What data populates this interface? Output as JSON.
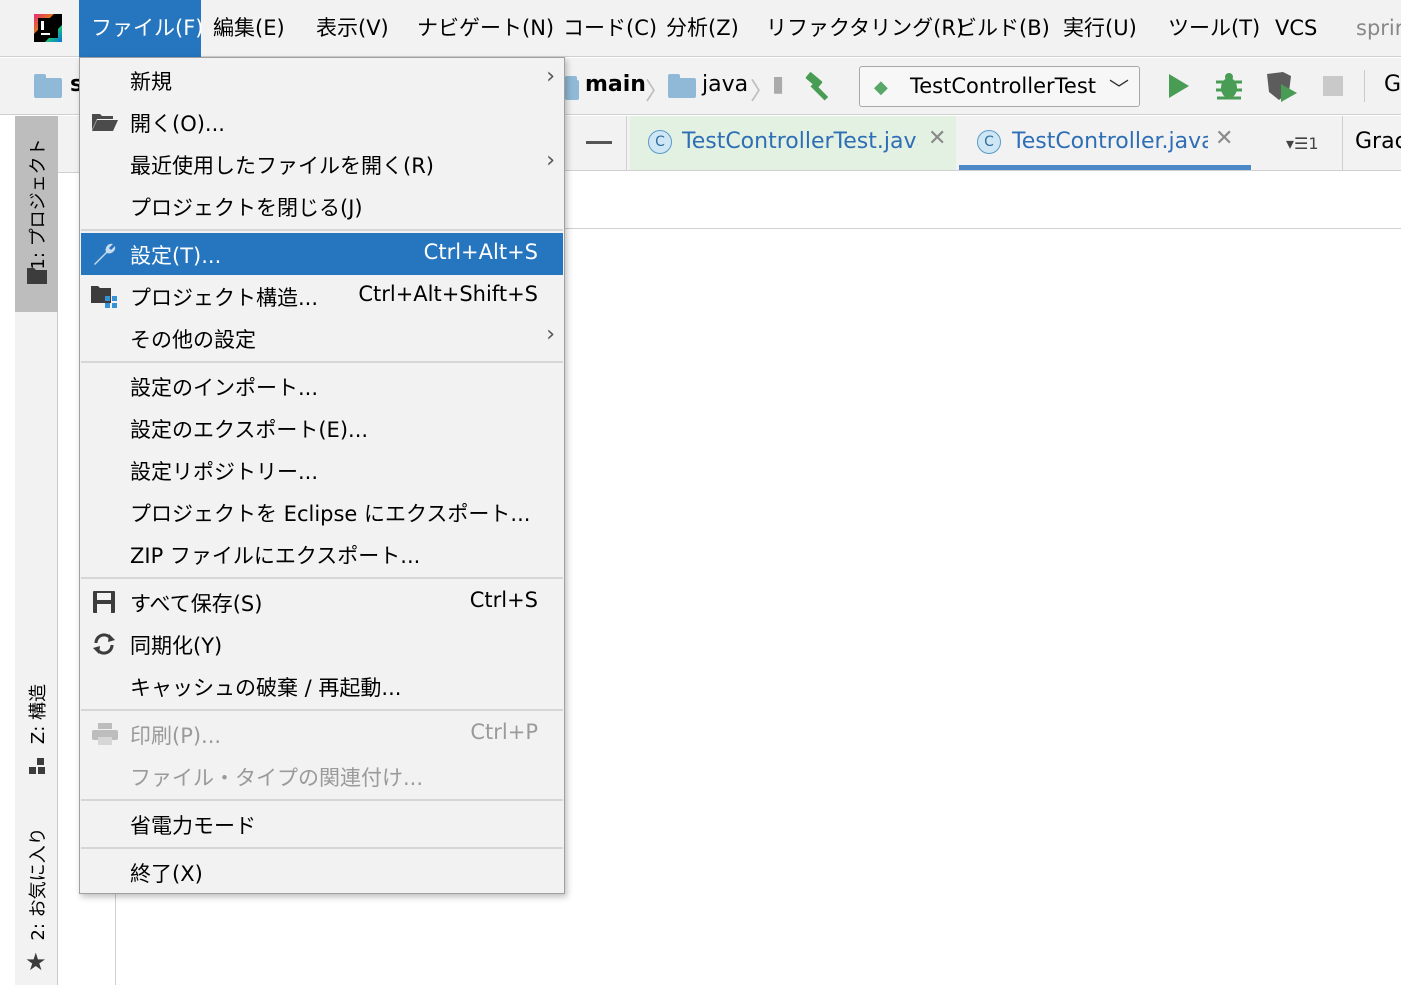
{
  "menubar": {
    "items": [
      {
        "label": "ファイル(F)",
        "active": true
      },
      {
        "label": "編集(E)"
      },
      {
        "label": "表示(V)"
      },
      {
        "label": "ナビゲート(N)"
      },
      {
        "label": "コード(C)"
      },
      {
        "label": "分析(Z)"
      },
      {
        "label": "リファクタリング(R)"
      },
      {
        "label": "ビルド(B)"
      },
      {
        "label": "実行(U)"
      },
      {
        "label": "ツール(T)"
      },
      {
        "label": "VCS"
      },
      {
        "label": "sprir"
      }
    ]
  },
  "navbar": {
    "crumb_first": "s",
    "crumb_main": "main",
    "crumb_java": "java",
    "run_config": "TestControllerTest",
    "right_cut": "G"
  },
  "tool_windows": {
    "project": "1: プロジェクト",
    "structure": "Z: 構造",
    "favorites": "2: お気に入り"
  },
  "editor": {
    "tabs": [
      {
        "name": "TestControllerTest.java",
        "icon": "C"
      },
      {
        "name": "TestController.java",
        "icon": "C"
      }
    ],
    "tab_count": "1",
    "gradle_cut": "Grac"
  },
  "file_menu": {
    "groups": [
      [
        {
          "label": "新規",
          "submenu": true,
          "icon": ""
        },
        {
          "label": "開く(O)...",
          "icon": "folder-open-icon"
        },
        {
          "label": "最近使用したファイルを開く(R)",
          "submenu": true
        },
        {
          "label": "プロジェクトを閉じる(J)"
        }
      ],
      [
        {
          "label": "設定(T)...",
          "shortcut": "Ctrl+Alt+S",
          "icon": "wrench-icon",
          "highlight": true
        },
        {
          "label": "プロジェクト構造...",
          "shortcut": "Ctrl+Alt+Shift+S",
          "icon": "project-structure-icon"
        },
        {
          "label": "その他の設定",
          "submenu": true
        }
      ],
      [
        {
          "label": "設定のインポート..."
        },
        {
          "label": "設定のエクスポート(E)..."
        },
        {
          "label": "設定リポジトリー..."
        },
        {
          "label": "プロジェクトを Eclipse にエクスポート..."
        },
        {
          "label": "ZIP ファイルにエクスポート..."
        }
      ],
      [
        {
          "label": "すべて保存(S)",
          "shortcut": "Ctrl+S",
          "icon": "save-icon"
        },
        {
          "label": "同期化(Y)",
          "icon": "sync-icon"
        },
        {
          "label": "キャッシュの破棄 / 再起動..."
        }
      ],
      [
        {
          "label": "印刷(P)...",
          "shortcut": "Ctrl+P",
          "icon": "print-icon",
          "disabled": true
        },
        {
          "label": "ファイル・タイプの関連付け...",
          "disabled": true
        }
      ],
      [
        {
          "label": "省電力モード"
        }
      ],
      [
        {
          "label": "終了(X)"
        }
      ]
    ]
  },
  "colors": {
    "accent": "#2675bf",
    "run_green": "#499c54",
    "folder_blue": "#8fb9d6"
  }
}
